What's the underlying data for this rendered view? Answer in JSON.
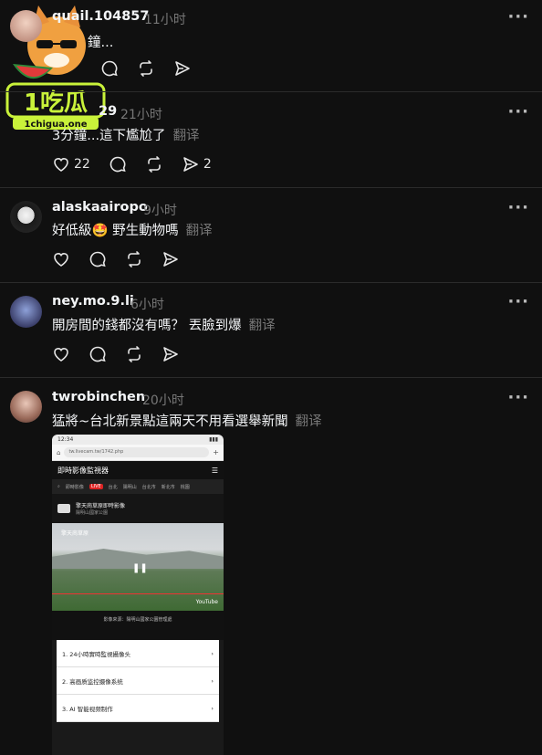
{
  "icons": {
    "like": "heart-icon",
    "reply": "comment-icon",
    "repost": "repost-icon",
    "share": "share-icon",
    "more": "more-icon"
  },
  "posts": [
    {
      "username": "quail.104857",
      "time": "11小时",
      "text": "鐘...",
      "translate": "",
      "likes": "",
      "shares": ""
    },
    {
      "username": "29",
      "time": "21小时",
      "text": "3分鐘...這下尷尬了",
      "translate": "翻译",
      "likes": "22",
      "shares": "2"
    },
    {
      "username": "alaskaairopo",
      "time": "9小时",
      "text": "好低級🤩 野生動物嗎",
      "translate": "翻译",
      "likes": "",
      "shares": ""
    },
    {
      "username": "ney.mo.9.li",
      "time": "6小时",
      "text": "開房間的錢都沒有嗎？ 丟臉到爆",
      "translate": "翻译",
      "likes": "",
      "shares": ""
    },
    {
      "username": "twrobinchen",
      "time": "20小时",
      "text": "猛將~台北新景點這兩天不用看選舉新聞",
      "translate": "翻译",
      "likes": "",
      "shares": ""
    }
  ],
  "more_label": "···",
  "watermark": {
    "brand": "1吃瓜",
    "site": "1chigua.one"
  },
  "screenshot": {
    "url": "tw.livecam.tw/1742.php",
    "title": "即時影像監視器",
    "live": "LIVE",
    "tabs": [
      "即時影像",
      "台北",
      "陽明山",
      "台北市",
      "新北市",
      "桃園"
    ],
    "camera_name": "擎天崗草原即時影像",
    "camera_sub": "陽明山國家公園",
    "video_label": "擎天崗草原",
    "youtube": "YouTube",
    "desc": "影像來源：陽明山國家公園管理處",
    "items": [
      "1. 24小時實時監視攝像头",
      "2. 高画质监控摄像系统",
      "3. AI 智能视频制作"
    ]
  }
}
